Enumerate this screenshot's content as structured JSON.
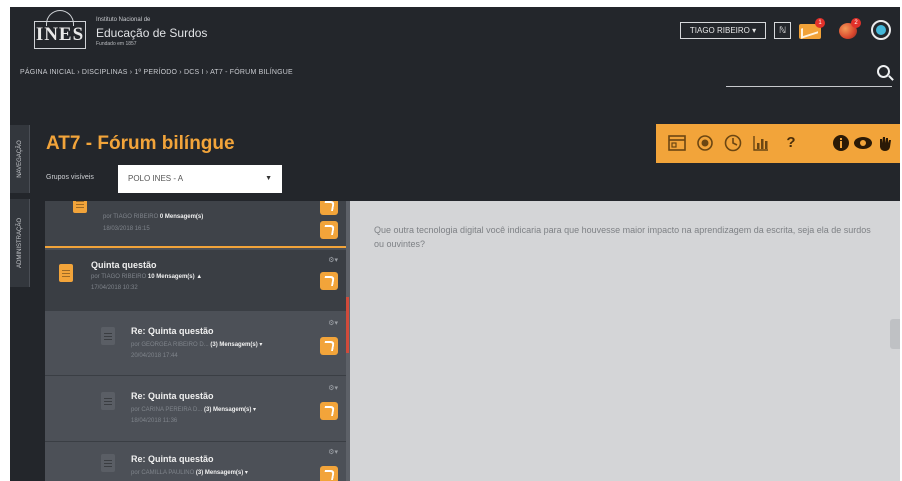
{
  "header": {
    "logo_text": "INES",
    "org_line1": "Instituto Nacional de",
    "org_line2": "Educação de Surdos",
    "org_line3": "Fundado em 1857",
    "user_menu": "TIAGO RIBEIRO ▾",
    "rss_label": "ℕ",
    "mail_badge": "1",
    "notification_badge": "2"
  },
  "breadcrumb": "PÁGINA INICIAL  ›  DISCIPLINAS  ›  1º PERÍODO  ›  DCS I  ›  AT7 - FÓRUM BILÍNGUE",
  "sidebar_tabs": {
    "navigation": "NAVEGAÇÃO",
    "administration": "ADMINISTRAÇÃO"
  },
  "forum": {
    "title": "AT7 - Fórum bilíngue",
    "groups_label": "Grupos visíveis",
    "groups_selected": "POLO INES - A"
  },
  "toolbar": {
    "help_label": "?"
  },
  "posts": [
    {
      "title": "",
      "author": "por TIAGO RIBEIRO",
      "count": "0 Mensagem(s)",
      "date": "18/03/2018 16:15"
    },
    {
      "title": "Quinta questão",
      "author": "por TIAGO RIBEIRO",
      "count": "10 Mensagem(s) ▲",
      "date": "17/04/2018 10:32"
    },
    {
      "title": "Re: Quinta questão",
      "author": "por GEORGEA RIBEIRO D...",
      "count": "(3) Mensagem(s) ▾",
      "date": "20/04/2018 17:44"
    },
    {
      "title": "Re: Quinta questão",
      "author": "por CARINA PEREIRA D...",
      "count": "(3) Mensagem(s) ▾",
      "date": "18/04/2018 11:36"
    },
    {
      "title": "Re: Quinta questão",
      "author": "por CAMILLA PAULINO",
      "count": "(3) Mensagem(s) ▾",
      "date": ""
    }
  ],
  "message": {
    "text": "Que outra tecnologia digital você indicaria para que houvesse maior impacto na aprendizagem da escrita, seja ela de surdos ou ouvintes?"
  },
  "colors": {
    "accent": "#f2a43a",
    "dark_bg": "#23262b",
    "panel_bg": "#4c5057",
    "content_bg": "#d4d5d7"
  },
  "icons": {
    "search": "search-icon",
    "mail": "mail-icon",
    "notifications": "notification-icon",
    "chat": "chat-icon",
    "reply": "reply-icon",
    "settings": "gear-icon"
  }
}
